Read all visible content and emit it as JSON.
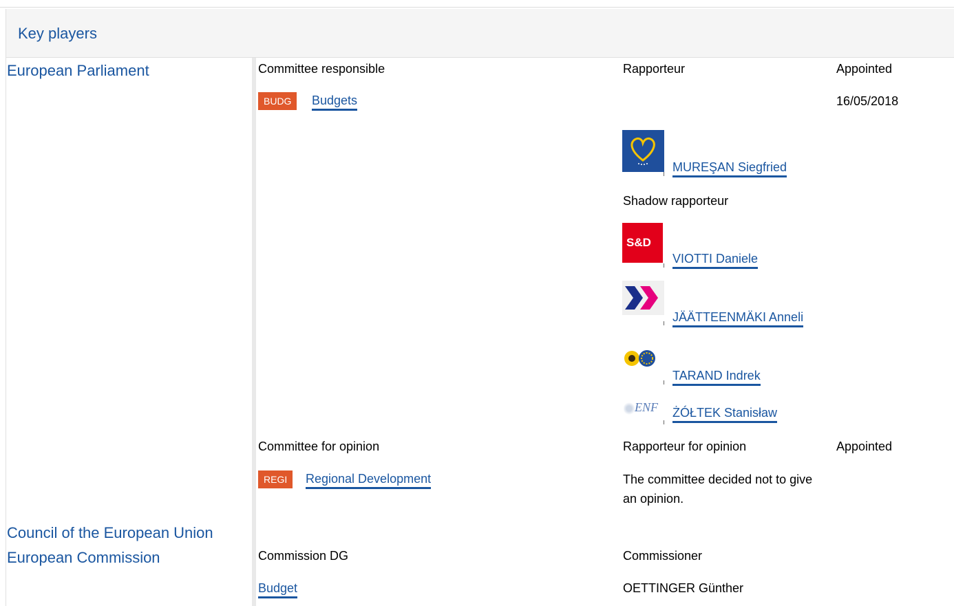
{
  "header": {
    "title": "Key players"
  },
  "institutions": {
    "ep": "European Parliament",
    "council": "Council of the European Union",
    "commission": "European Commission"
  },
  "responsible": {
    "col_committee": "Committee responsible",
    "col_rapporteur": "Rapporteur",
    "col_appointed": "Appointed",
    "committee_code": "BUDG",
    "committee_name": "Budgets",
    "appointed_date": "16/05/2018",
    "rapporteur": {
      "name": "MUREŞAN Siegfried",
      "group_icon": "epp-logo-icon"
    },
    "shadow_label": "Shadow rapporteur",
    "shadows": [
      {
        "name": "VIOTTI Daniele",
        "group_icon": "sd-logo-icon",
        "logo_text": "S&D"
      },
      {
        "name": "JÄÄTTEENMÄKI Anneli",
        "group_icon": "alde-logo-icon"
      },
      {
        "name": "TARAND Indrek",
        "group_icon": "greens-efa-logo-icon"
      },
      {
        "name": "ŻÓŁTEK Stanisław",
        "group_icon": "enf-logo-icon",
        "logo_text": "ENF"
      }
    ]
  },
  "opinion": {
    "col_committee": "Committee for opinion",
    "col_rapporteur": "Rapporteur for opinion",
    "col_appointed": "Appointed",
    "committee_code": "REGI",
    "committee_name": "Regional Development",
    "note": "The committee decided not to give an opinion."
  },
  "commission": {
    "col_dg": "Commission DG",
    "col_commissioner": "Commissioner",
    "dg": "Budget",
    "commissioner": "OETTINGER Günther"
  },
  "colors": {
    "link": "#1a56a0",
    "badge": "#e0582b",
    "header_bg": "#f5f5f5"
  }
}
